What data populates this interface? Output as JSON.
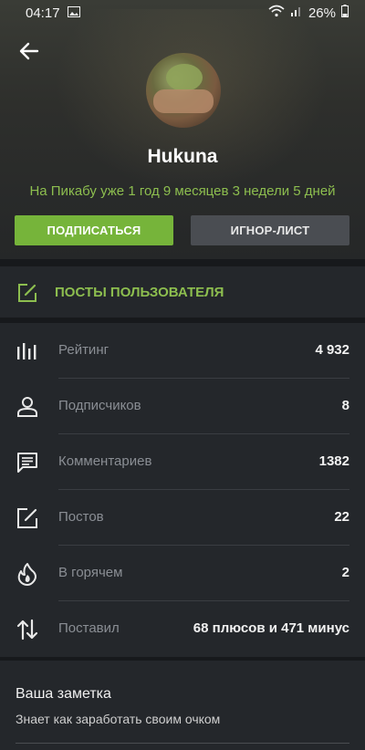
{
  "status_bar": {
    "time": "04:17",
    "battery": "26%"
  },
  "profile": {
    "username": "Hukuna",
    "since": "На Пикабу уже 1 год 9 месяцев 3 недели 5 дней",
    "subscribe_label": "ПОДПИСАТЬСЯ",
    "ignore_label": "ИГНОР-ЛИСТ"
  },
  "posts_link": {
    "label": "ПОСТЫ ПОЛЬЗОВАТЕЛЯ"
  },
  "stats": [
    {
      "label": "Рейтинг",
      "value": "4 932",
      "icon": "rating-bars-icon"
    },
    {
      "label": "Подписчиков",
      "value": "8",
      "icon": "user-icon"
    },
    {
      "label": "Комментариев",
      "value": "1382",
      "icon": "comment-icon"
    },
    {
      "label": "Постов",
      "value": "22",
      "icon": "edit-icon"
    },
    {
      "label": "В горячем",
      "value": "2",
      "icon": "flame-icon"
    },
    {
      "label": "Поставил",
      "value": "68 плюсов и 471 минус",
      "icon": "up-down-arrows-icon"
    }
  ],
  "note": {
    "title": "Ваша заметка",
    "text": "Знает как заработать своим очком"
  },
  "colors": {
    "accent": "#8dbe4f",
    "subscribe": "#76b43a",
    "background": "#1f2226",
    "card": "#24272b"
  }
}
